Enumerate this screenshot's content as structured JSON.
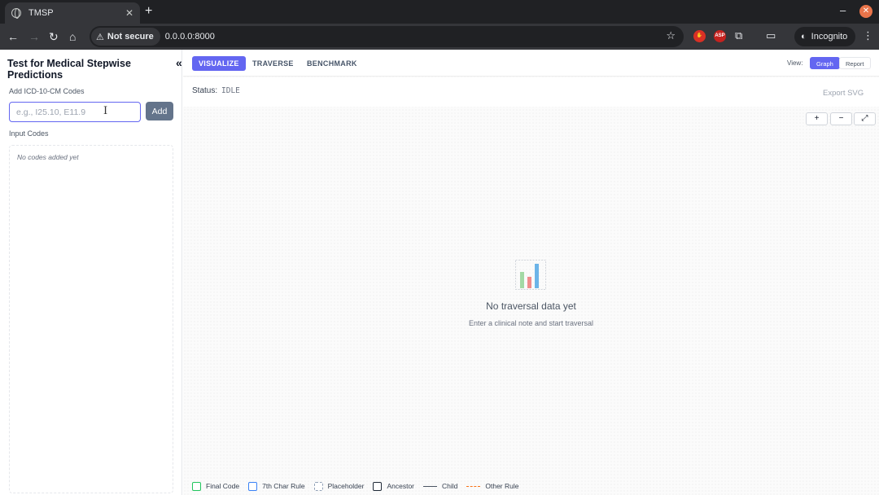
{
  "browser": {
    "tab_title": "TMSP",
    "tab_close": "✕",
    "new_tab": "+",
    "security_label": "Not secure",
    "url": "0.0.0.0:8000",
    "profile_label": "Incognito",
    "ext_asp_label": "ASP"
  },
  "sidebar": {
    "title": "Test for Medical Stepwise Predictions",
    "collapse": "«",
    "add_label": "Add ICD-10-CM Codes",
    "input_placeholder": "e.g., I25.10, E11.9",
    "input_value": "",
    "add_button": "Add",
    "codes_label": "Input Codes",
    "codes_empty": "No codes added yet"
  },
  "main": {
    "tabs": [
      {
        "label": "VISUALIZE",
        "active": true
      },
      {
        "label": "TRAVERSE",
        "active": false
      },
      {
        "label": "BENCHMARK",
        "active": false
      }
    ],
    "view_label": "View:",
    "view_options": [
      {
        "label": "Graph",
        "active": true
      },
      {
        "label": "Report",
        "active": false
      }
    ],
    "status_label": "Status:",
    "status_value": "IDLE",
    "export_label": "Export SVG",
    "zoom": {
      "in": "+",
      "out": "−",
      "fit": "⤢"
    },
    "empty_title": "No traversal data yet",
    "empty_subtitle": "Enter a clinical note and start traversal",
    "empty_icon": "bar-chart-icon"
  },
  "legend": [
    {
      "label": "Final Code",
      "kind": "final",
      "color": "#22c55e"
    },
    {
      "label": "7th Char Rule",
      "kind": "seventh",
      "color": "#3b82f6"
    },
    {
      "label": "Placeholder",
      "kind": "placeholder",
      "color": "#94a3b8"
    },
    {
      "label": "Ancestor",
      "kind": "ancestor",
      "color": "#1f2937"
    },
    {
      "label": "Child",
      "kind": "child",
      "color": "#4b5563"
    },
    {
      "label": "Other Rule",
      "kind": "other",
      "color": "#f97316"
    }
  ],
  "colors": {
    "accent": "#6366f1",
    "add_button": "#64748b"
  }
}
